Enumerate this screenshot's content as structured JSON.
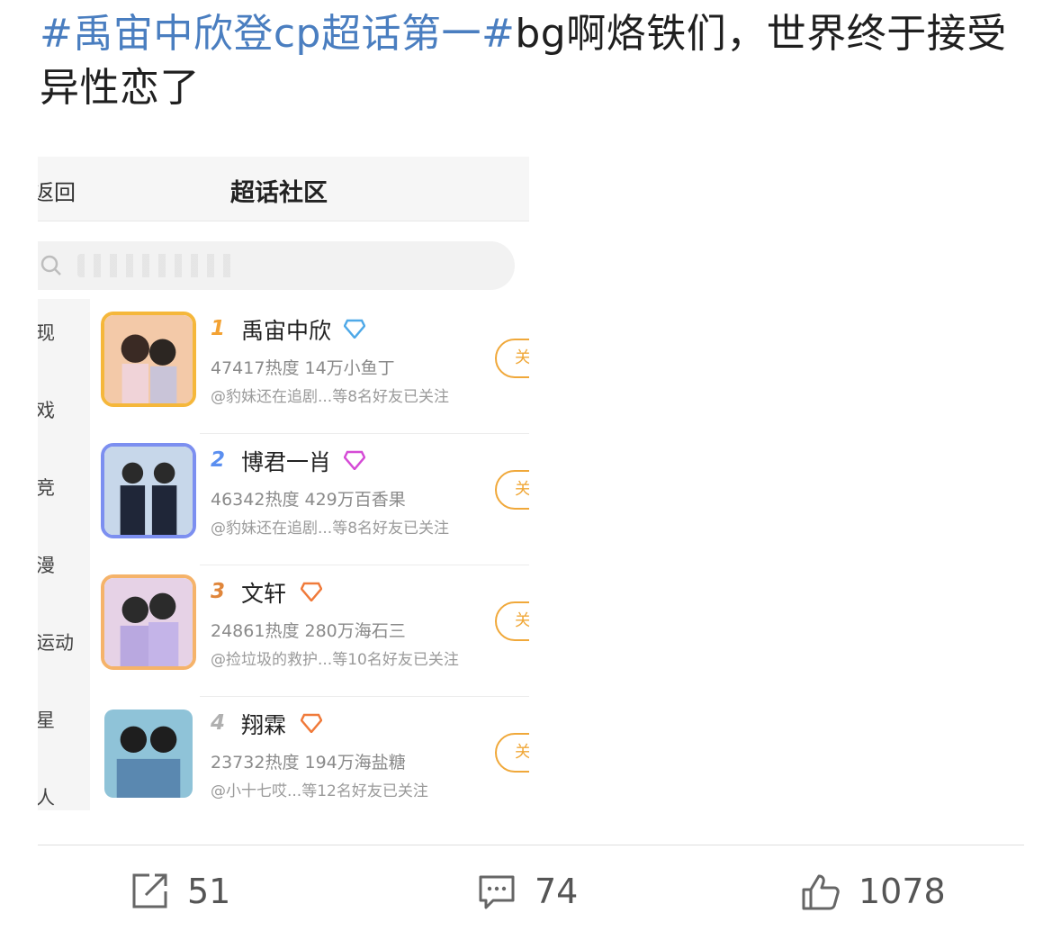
{
  "post": {
    "topic1": "#禹宙中欣登cp超话第一#",
    "text": "bg啊烙铁们，世界终于接受异性恋了"
  },
  "screenshot": {
    "back_label": "返回",
    "title": "超话社区",
    "categories": [
      "现",
      "戏",
      "竞",
      "漫",
      "运动",
      "星",
      "人"
    ],
    "items": [
      {
        "rank": "1",
        "name": "禹宙中欣",
        "stats": "47417热度 14万小鱼丁",
        "friends": "@豹妹还在追剧...等8名好友已关注",
        "follow": "关",
        "rank_color": "#f3a233",
        "badge_color": "#4fa9e8",
        "frame_color": "#f5b73b"
      },
      {
        "rank": "2",
        "name": "博君一肖",
        "stats": "46342热度 429万百香果",
        "friends": "@豹妹还在追剧...等8名好友已关注",
        "follow": "关",
        "rank_color": "#5b8ff0",
        "badge_color": "#d54bd6",
        "frame_color": "#7c8ff0"
      },
      {
        "rank": "3",
        "name": "文轩",
        "stats": "24861热度 280万海石三",
        "friends": "@捡垃圾的救护...等10名好友已关注",
        "follow": "关",
        "rank_color": "#e0863b",
        "badge_color": "#f07a3a",
        "frame_color": "#f5b36a"
      },
      {
        "rank": "4",
        "name": "翔霖",
        "stats": "23732热度 194万海盐糖",
        "friends": "@小十七哎...等12名好友已关注",
        "follow": "关",
        "rank_color": "#b0b0b0",
        "badge_color": "#f07a3a",
        "frame_color": "#ffffff"
      }
    ]
  },
  "actions": {
    "share_count": "51",
    "comment_count": "74",
    "like_count": "1078"
  }
}
